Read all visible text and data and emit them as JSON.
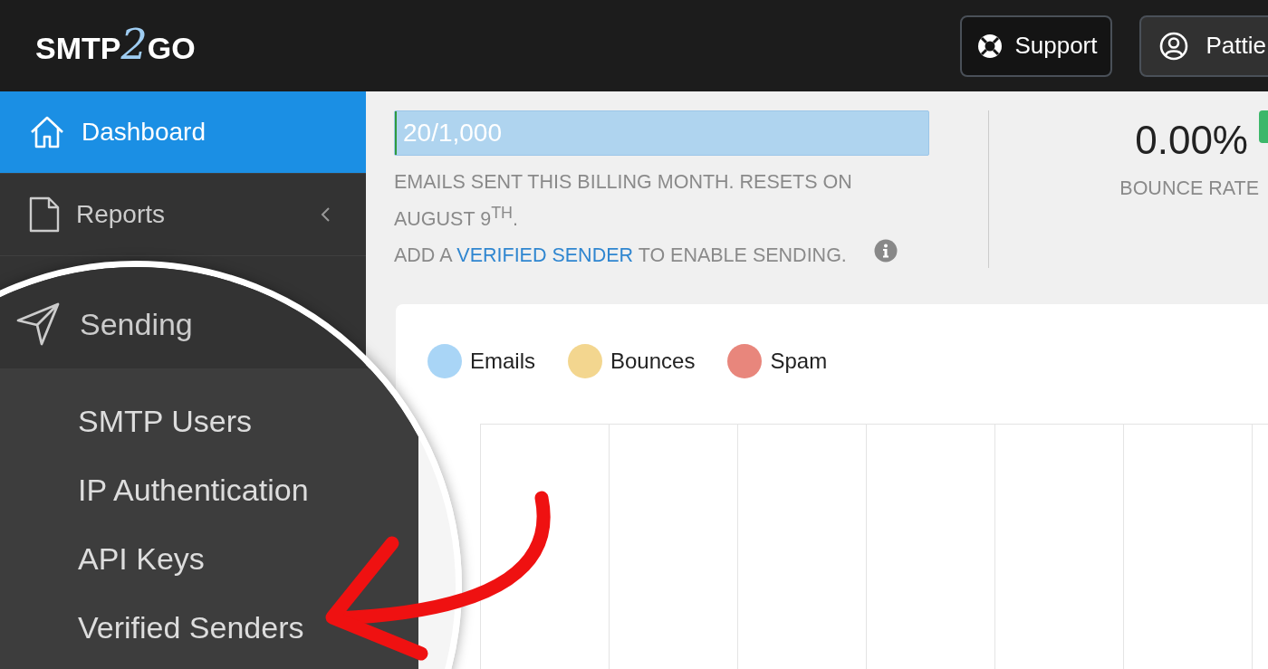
{
  "header": {
    "logo": {
      "before": "SMTP",
      "mark": "2",
      "after": "GO"
    },
    "buttons": [
      {
        "label": "Support",
        "kind": "support"
      },
      {
        "label": "Pattie",
        "kind": "user"
      }
    ]
  },
  "sidebar": {
    "items": [
      {
        "label": "Dashboard",
        "kind": "home",
        "selected": true
      },
      {
        "label": "Reports",
        "kind": "document",
        "selected": false,
        "expanded": false
      }
    ]
  },
  "magnifier": {
    "section": {
      "label": "Sending",
      "kind": "send",
      "children": [
        {
          "label": "SMTP Users"
        },
        {
          "label": "IP Authentication"
        },
        {
          "label": "API Keys"
        },
        {
          "label": "Verified Senders"
        }
      ]
    }
  },
  "usage": {
    "value": "20/1,000",
    "level": 0.004,
    "note": "EMAILS SENT THIS BILLING MONTH. RESETS ON AUGUST 9$^{TH}$.",
    "notice_before": "ADD A",
    "link": "VERIFIED SENDER",
    "notice_after": "TO ENABLE SENDING."
  },
  "bounce": {
    "value": "0.00%",
    "label": "BOUNCE RATE"
  },
  "legend": [
    {
      "label": "Emails",
      "color": "#a9d5f6"
    },
    {
      "label": "Bounces",
      "color": "#f3d68f"
    },
    {
      "label": "Spam",
      "color": "#e8867c"
    }
  ]
}
